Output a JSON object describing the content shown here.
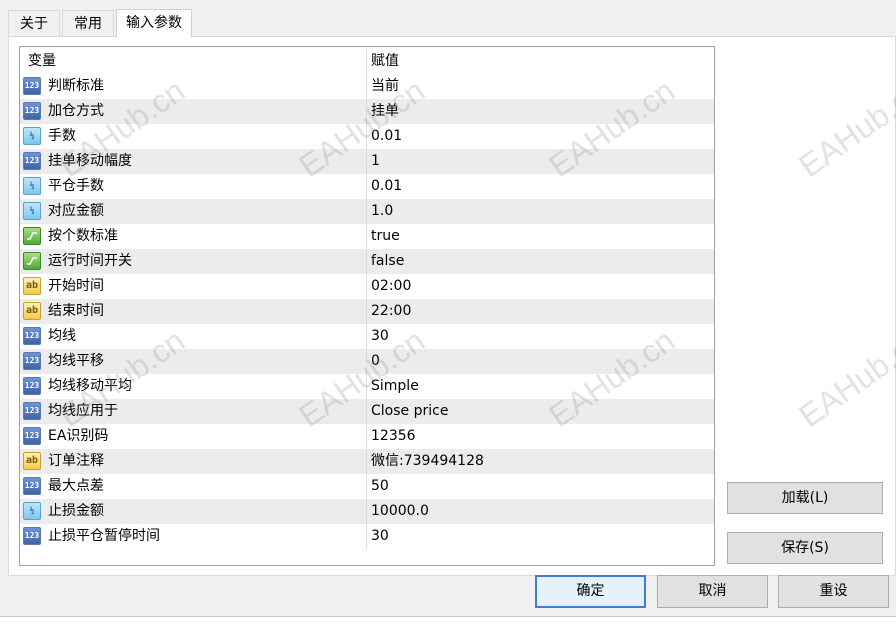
{
  "tabs": [
    {
      "label": "关于"
    },
    {
      "label": "常用"
    },
    {
      "label": "输入参数"
    }
  ],
  "table": {
    "header": {
      "variable": "变量",
      "value": "赋值"
    },
    "rows": [
      {
        "icon": "int",
        "name": "判断标准",
        "value": "当前"
      },
      {
        "icon": "int",
        "name": "加仓方式",
        "value": "挂单"
      },
      {
        "icon": "double",
        "name": "手数",
        "value": "0.01"
      },
      {
        "icon": "int",
        "name": "挂单移动幅度",
        "value": "1"
      },
      {
        "icon": "double",
        "name": "平仓手数",
        "value": "0.01"
      },
      {
        "icon": "double",
        "name": "对应金额",
        "value": "1.0"
      },
      {
        "icon": "bool",
        "name": "按个数标准",
        "value": "true"
      },
      {
        "icon": "bool",
        "name": "运行时间开关",
        "value": "false"
      },
      {
        "icon": "string",
        "name": "开始时间",
        "value": "02:00"
      },
      {
        "icon": "string",
        "name": "结束时间",
        "value": "22:00"
      },
      {
        "icon": "int",
        "name": "均线",
        "value": "30"
      },
      {
        "icon": "int",
        "name": "均线平移",
        "value": "0"
      },
      {
        "icon": "int",
        "name": "均线移动平均",
        "value": "Simple"
      },
      {
        "icon": "int",
        "name": "均线应用于",
        "value": "Close price"
      },
      {
        "icon": "int",
        "name": "EA识别码",
        "value": "12356"
      },
      {
        "icon": "string",
        "name": "订单注释",
        "value": "微信:739494128"
      },
      {
        "icon": "int",
        "name": "最大点差",
        "value": "50"
      },
      {
        "icon": "double",
        "name": "止损金额",
        "value": "10000.0"
      },
      {
        "icon": "int",
        "name": "止损平仓暂停时间",
        "value": "30"
      }
    ]
  },
  "icons": {
    "int": "123",
    "double": "½",
    "bool": "toggle-icon",
    "string": "ab"
  },
  "side_buttons": {
    "load": "加载(L)",
    "save": "保存(S)"
  },
  "footer_buttons": {
    "ok": "确定",
    "cancel": "取消",
    "reset": "重设"
  },
  "watermark": "EAHub.cn"
}
